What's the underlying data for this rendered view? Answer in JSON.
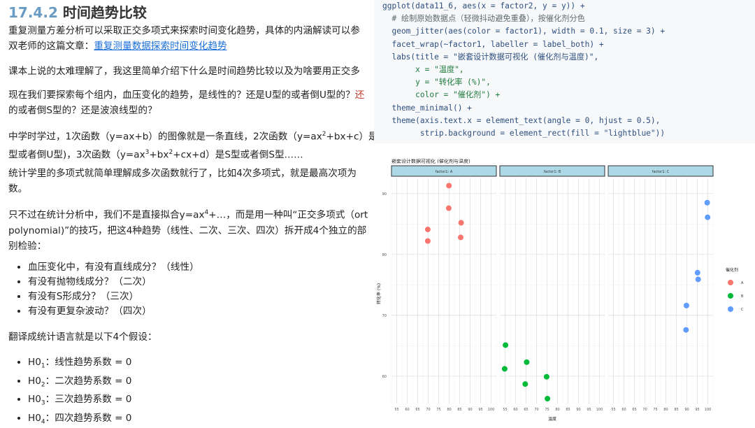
{
  "article": {
    "section_number": "17.4.2",
    "section_title": "时间趋势比较",
    "p1_line1": "重复测量方差分析可以采取正交多项式来探索时间变化趋势，具体的内涵解读可以参",
    "p1_line2_prefix": "双老师的这篇文章：",
    "p1_link": "重复测量数据探索时间变化趋势",
    "p2": "课本上说的太难理解了，我这里简单介绍下什么是时间趋势比较以及为啥要用正交多",
    "p3_line1_a": "现在我们要探索每个组内，血压变化的趋势，是线性的？还是U型的或者倒U型的？",
    "p3_line1_b": "还",
    "p3_line2": "的或者倒S型的？还是波浪线型的？",
    "p4_line1_a": "中学时学过，1次函数（y=ax+b）的图像就是一条直线，2次函数（y=ax",
    "p4_sup1": "2",
    "p4_line1_b": "+bx+c）是抛",
    "p4_line2_a": "型或者倒U型)，3次函数（y=ax",
    "p4_sup2": "3",
    "p4_line2_b": "+bx",
    "p4_sup3": "2",
    "p4_line2_c": "+cx+d）是S型或者倒S型……",
    "p5_line1": "统计学里的多项式就简单理解成多次函数就行了，比如4次多项式，就是最高次项为",
    "p5_line2": "数。",
    "p6_line1_a": "只不过在统计分析中，我们不是直接拟合y=ax",
    "p6_sup": "4",
    "p6_line1_b": "+…，而是用一种叫“正交多项式（ort",
    "p6_line2": "polynomial)”的技巧，把这4种趋势（线性、二次、三次、四次）拆开成4个独立的部",
    "p6_line3": "别检验：",
    "bullets": [
      "血压变化中，有没有直线成分？（线性）",
      "有没有抛物线成分？（二次）",
      "有没有S形成分？（三次）",
      "有没有更复杂波动？（四次）"
    ],
    "p7": "翻译成统计语言就是以下4个假设：",
    "hypotheses": [
      {
        "h": "H0",
        "sub": "1",
        "text": "：线性趋势系数 = 0"
      },
      {
        "h": "H0",
        "sub": "2",
        "text": "：二次趋势系数 = 0"
      },
      {
        "h": "H0",
        "sub": "3",
        "text": "：三次趋势系数 = 0"
      },
      {
        "h": "H0",
        "sub": "4",
        "text": "：四次趋势系数 = 0"
      }
    ]
  },
  "code_lines": [
    "ggplot(data11_6, aes(x = factor2, y = y)) +",
    "  # 绘制原始数据点（轻微抖动避免重叠），按催化剂分色",
    "  geom_jitter(aes(color = factor1), width = 0.1, size = 3) +",
    "  facet_wrap(~factor1, labeller = label_both) +",
    "  labs(title = \"嵌套设计数据可视化 (催化剂与温度)\",",
    "       x = \"温度\",",
    "       y = \"转化率 (%)\",",
    "       color = \"催化剂\") +",
    "  theme_minimal() +",
    "  theme(axis.text.x = element_text(angle = 0, hjust = 0.5),",
    "        strip.background = element_rect(fill = \"lightblue\"))"
  ],
  "chart_data": {
    "type": "scatter",
    "title": "嵌套设计数据可视化 (催化剂与温度)",
    "xlabel": "温度",
    "ylabel": "转化率 (%)",
    "legend_title": "催化剂",
    "legend_position": "right",
    "x_ticks": [
      55,
      60,
      65,
      70,
      75,
      80,
      85,
      90,
      95,
      100
    ],
    "x_range": [
      52.5,
      102.5
    ],
    "y_ticks": [
      60,
      70,
      80,
      90
    ],
    "y_range": [
      55.5,
      92.5
    ],
    "grid": true,
    "facets": [
      {
        "label": "factor1: A",
        "series": "A",
        "color": "#F8766D",
        "points": [
          {
            "x": 69.8,
            "y": 84.1
          },
          {
            "x": 69.8,
            "y": 82.2
          },
          {
            "x": 79.9,
            "y": 91.3
          },
          {
            "x": 79.8,
            "y": 87.6
          },
          {
            "x": 85.7,
            "y": 85.2
          },
          {
            "x": 85.5,
            "y": 82.8
          }
        ]
      },
      {
        "label": "factor1: B",
        "series": "B",
        "color": "#00BA38",
        "points": [
          {
            "x": 55.2,
            "y": 65.1
          },
          {
            "x": 54.8,
            "y": 61.2
          },
          {
            "x": 65.3,
            "y": 62.3
          },
          {
            "x": 64.6,
            "y": 58.7
          },
          {
            "x": 74.8,
            "y": 59.9
          },
          {
            "x": 75.2,
            "y": 56.3
          }
        ]
      },
      {
        "label": "factor1: C",
        "series": "C",
        "color": "#619CFF",
        "points": [
          {
            "x": 89.8,
            "y": 71.6
          },
          {
            "x": 89.6,
            "y": 67.6
          },
          {
            "x": 95.1,
            "y": 77.0
          },
          {
            "x": 95.4,
            "y": 75.9
          },
          {
            "x": 99.7,
            "y": 88.5
          },
          {
            "x": 99.9,
            "y": 86.1
          }
        ]
      }
    ],
    "legend": [
      {
        "label": "A",
        "color": "#F8766D"
      },
      {
        "label": "B",
        "color": "#00BA38"
      },
      {
        "label": "C",
        "color": "#619CFF"
      }
    ]
  }
}
